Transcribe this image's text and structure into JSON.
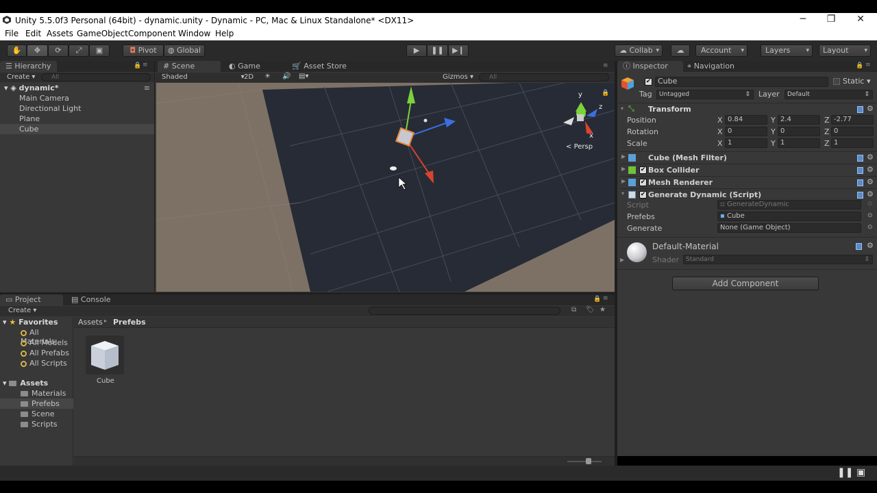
{
  "window": {
    "title": "Unity 5.5.0f3 Personal (64bit) - dynamic.unity - Dynamic - PC, Mac & Linux Standalone* <DX11>"
  },
  "menu": [
    "File",
    "Edit",
    "Assets",
    "GameObject",
    "Component",
    "Window",
    "Help"
  ],
  "toolbar": {
    "pivot": "Pivot",
    "global": "Global",
    "collab": "Collab",
    "account": "Account",
    "layers": "Layers",
    "layout": "Layout"
  },
  "hierarchy": {
    "tab": "Hierarchy",
    "create": "Create",
    "search_placeholder": "All",
    "scene": "dynamic*",
    "items": [
      "Main Camera",
      "Directional Light",
      "Plane",
      "Cube"
    ]
  },
  "scene": {
    "tabs": [
      "Scene",
      "Game",
      "Asset Store"
    ],
    "shading": "Shaded",
    "mode2d": "2D",
    "gizmos": "Gizmos",
    "search_placeholder": "All",
    "persp": "Persp",
    "axis_y": "y",
    "axis_z": "z",
    "axis_x": "x"
  },
  "inspector": {
    "tabs": [
      "Inspector",
      "Navigation"
    ],
    "object_name": "Cube",
    "static": "Static",
    "tag_label": "Tag",
    "tag": "Untagged",
    "layer_label": "Layer",
    "layer": "Default",
    "transform": {
      "title": "Transform",
      "position": {
        "label": "Position",
        "x": "0.84",
        "y": "2.4",
        "z": "-2.77"
      },
      "rotation": {
        "label": "Rotation",
        "x": "0",
        "y": "0",
        "z": "0"
      },
      "scale": {
        "label": "Scale",
        "x": "1",
        "y": "1",
        "z": "1"
      }
    },
    "axis": {
      "x": "X",
      "y": "Y",
      "z": "Z"
    },
    "components": [
      "Cube (Mesh Filter)",
      "Box Collider",
      "Mesh Renderer",
      "Generate Dynamic (Script)"
    ],
    "script": {
      "script_label": "Script",
      "script_value": "GenerateDynamic",
      "prefabs_label": "Prefebs",
      "prefabs_value": "Cube",
      "generate_label": "Generate",
      "generate_value": "None (Game Object)"
    },
    "material": {
      "name": "Default-Material",
      "shader_label": "Shader",
      "shader": "Standard"
    },
    "add_component": "Add Component"
  },
  "project": {
    "tabs": [
      "Project",
      "Console"
    ],
    "create": "Create",
    "favorites": {
      "title": "Favorites",
      "items": [
        "All Materials",
        "All Models",
        "All Prefabs",
        "All Scripts"
      ]
    },
    "assets": {
      "title": "Assets",
      "items": [
        "Materials",
        "Prefebs",
        "Scene",
        "Scripts"
      ]
    },
    "breadcrumb": [
      "Assets",
      "Prefebs"
    ],
    "files": [
      {
        "name": "Cube"
      }
    ]
  }
}
